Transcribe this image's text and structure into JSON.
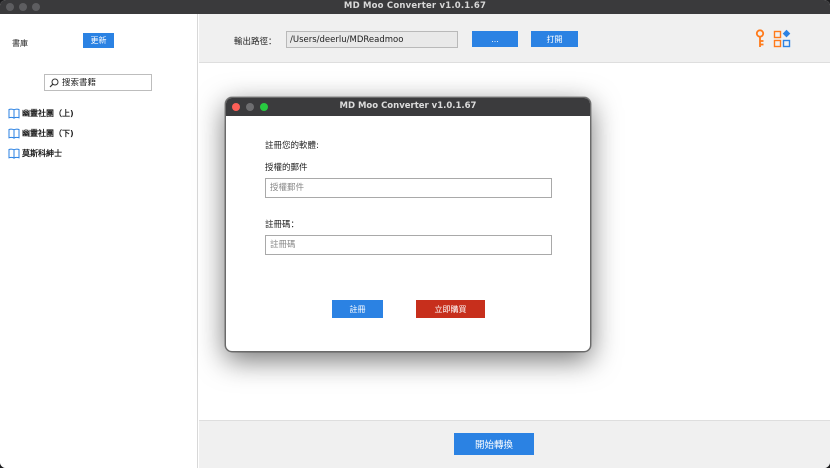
{
  "window": {
    "title": "MD Moo Converter v1.0.1.67"
  },
  "sidebar": {
    "library_label": "書庫",
    "refresh_label": "更新",
    "search_placeholder": "搜索書籍",
    "books": [
      {
        "title": "幽靈社團（上)"
      },
      {
        "title": "幽靈社團（下)"
      },
      {
        "title": "莫斯科紳士"
      }
    ]
  },
  "toolbar": {
    "output_path_label": "輸出路徑：",
    "output_path_value": "/Users/deerlu/MDReadmoo",
    "browse_label": "...",
    "open_label": "打開",
    "key_icon": "key-icon",
    "apps_icon": "apps-icon",
    "accent_color": "#ff7a1a"
  },
  "footer": {
    "start_label": "開始轉換"
  },
  "dialog": {
    "title": "MD Moo Converter v1.0.1.67",
    "heading": "註冊您的軟體:",
    "email_label": "授權的郵件",
    "email_value": "",
    "email_placeholder": "授權郵件",
    "code_label": "註冊碼：",
    "code_value": "",
    "code_placeholder": "註冊碼",
    "register_label": "註冊",
    "buy_label": "立即購買"
  },
  "colors": {
    "primary": "#2b82e3",
    "danger": "#c72f1c"
  }
}
